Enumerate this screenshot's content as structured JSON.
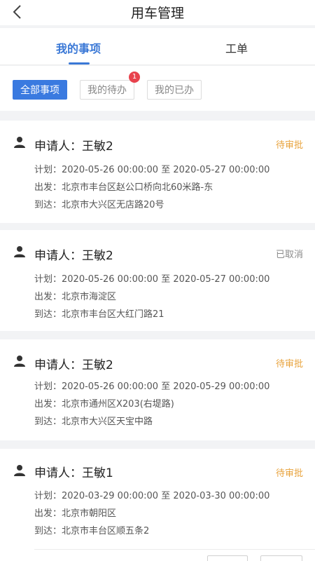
{
  "header": {
    "title": "用车管理"
  },
  "tabs": [
    {
      "label": "我的事项",
      "active": true
    },
    {
      "label": "工单",
      "active": false
    }
  ],
  "filters": [
    {
      "label": "全部事项",
      "active": true
    },
    {
      "label": "我的待办",
      "active": false,
      "badge": "1"
    },
    {
      "label": "我的已办",
      "active": false
    }
  ],
  "colors": {
    "accent": "#3a78d6",
    "pending": "#e8a33d",
    "cancelled": "#8a8a8a",
    "badge": "#e8424d"
  },
  "cards": [
    {
      "applicant": "申请人：王敏2",
      "status": "待审批",
      "plan": "计划：2020-05-26 00:00:00 至 2020-05-27 00:00:00",
      "depart": "出发：北京市丰台区赵公口桥向北60米路-东",
      "arrive": "到达：北京市大兴区无店路20号"
    },
    {
      "applicant": "申请人：王敏2",
      "status": "已取消",
      "plan": "计划：2020-05-26 00:00:00 至 2020-05-27 00:00:00",
      "depart": "出发：北京市海淀区",
      "arrive": "到达：北京市丰台区大红门路21"
    },
    {
      "applicant": "申请人：王敏2",
      "status": "待审批",
      "plan": "计划：2020-05-26 00:00:00 至 2020-05-29 00:00:00",
      "depart": "出发：北京市通州区X203(右堤路)",
      "arrive": "到达：北京市大兴区天宝中路"
    },
    {
      "applicant": "申请人：王敏1",
      "status": "待审批",
      "plan": "计划：2020-03-29 00:00:00 至 2020-03-30 00:00:00",
      "depart": "出发：北京市朝阳区",
      "arrive": "到达：北京市丰台区顺五条2"
    }
  ]
}
